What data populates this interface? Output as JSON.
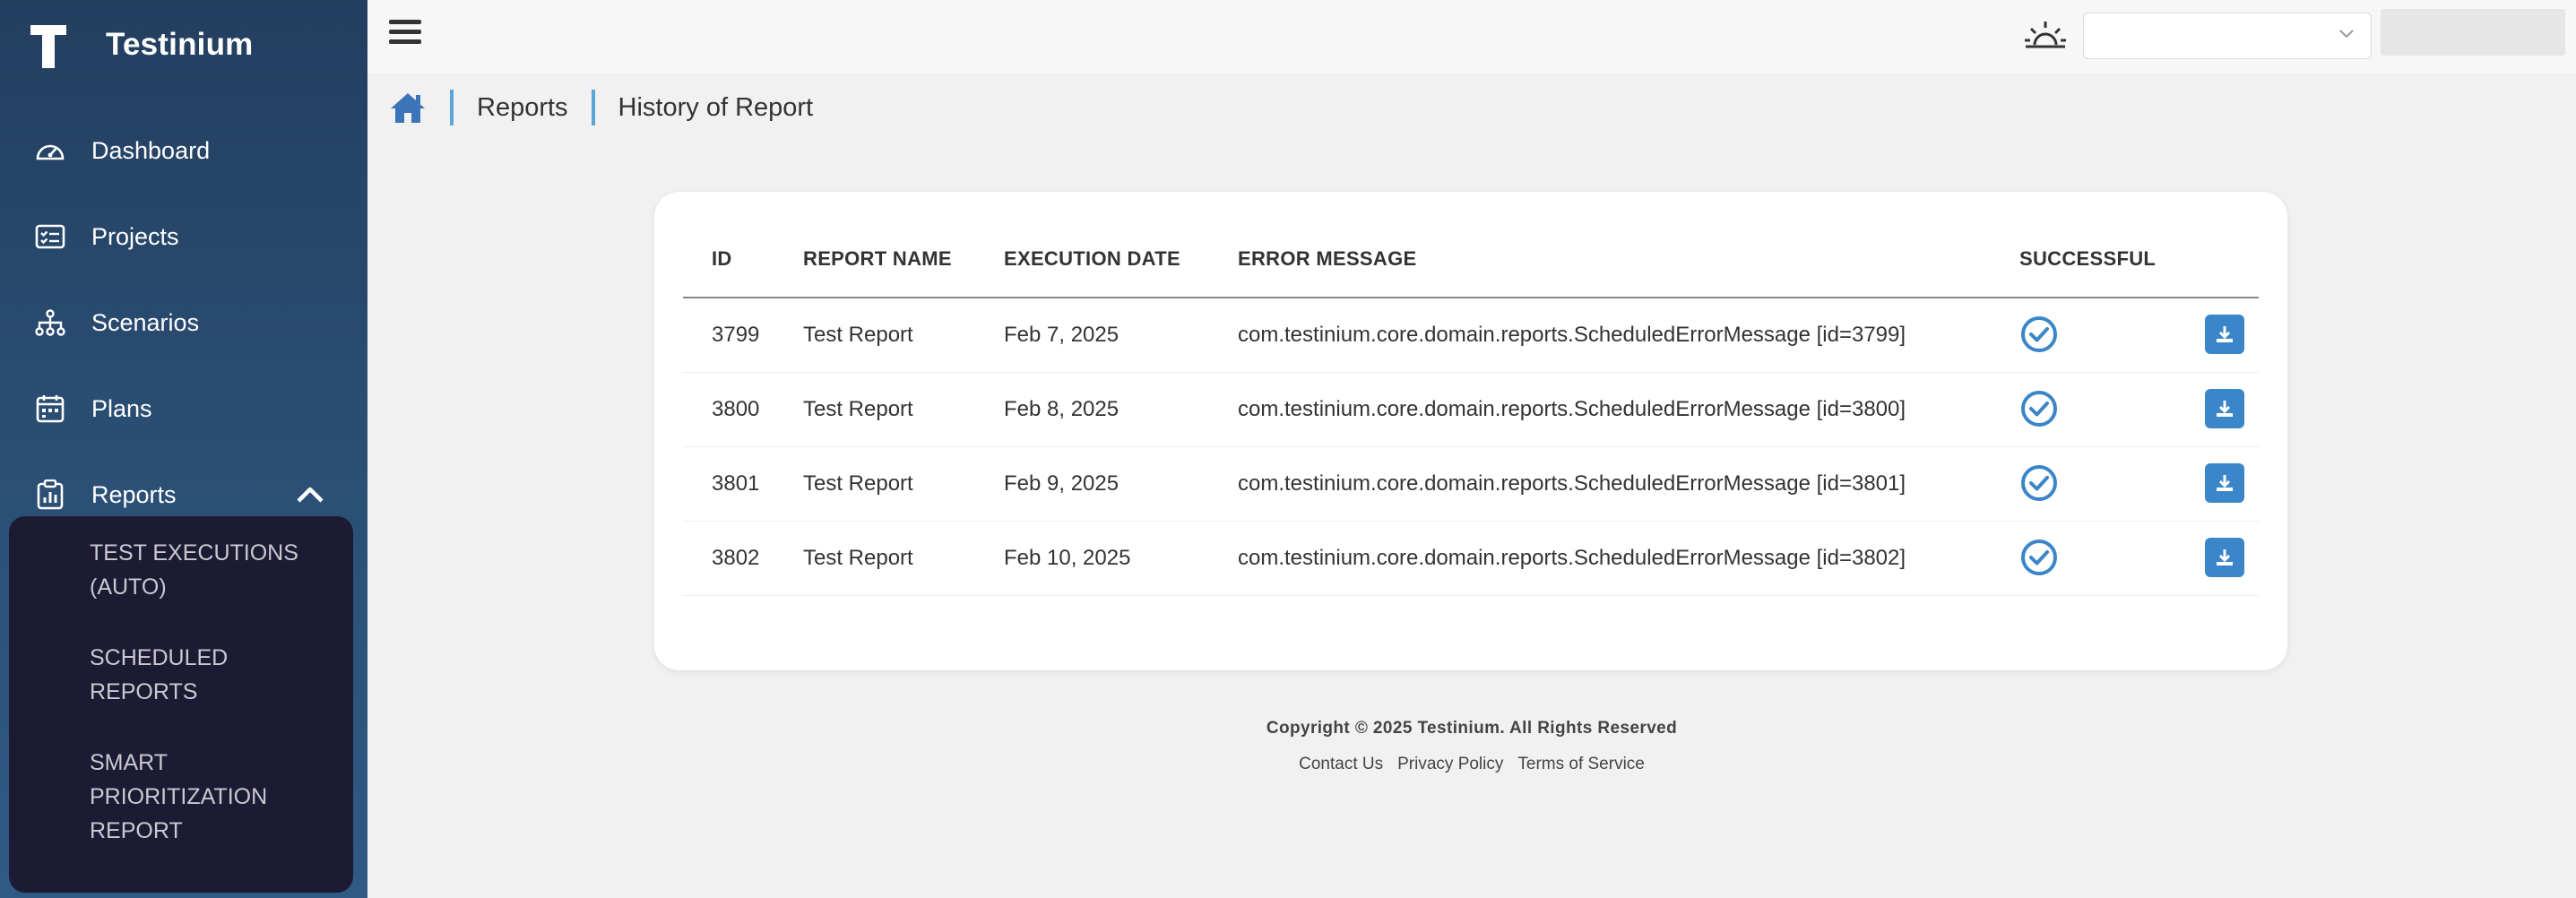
{
  "brand": {
    "name": "Testinium"
  },
  "sidebar": {
    "items": [
      {
        "label": "Dashboard",
        "icon": "gauge-icon"
      },
      {
        "label": "Projects",
        "icon": "checklist-icon"
      },
      {
        "label": "Scenarios",
        "icon": "hierarchy-icon"
      },
      {
        "label": "Plans",
        "icon": "calendar-icon"
      },
      {
        "label": "Reports",
        "icon": "clipboard-chart-icon",
        "expanded": true
      }
    ],
    "submenu": [
      {
        "label": "TEST EXECUTIONS (AUTO)"
      },
      {
        "label": "SCHEDULED REPORTS"
      },
      {
        "label": "SMART PRIORITIZATION REPORT"
      }
    ]
  },
  "topbar": {
    "select_value": ""
  },
  "breadcrumb": {
    "items": [
      "Reports",
      "History of Report"
    ]
  },
  "table": {
    "columns": [
      "ID",
      "REPORT NAME",
      "EXECUTION DATE",
      "ERROR MESSAGE",
      "SUCCESSFUL"
    ],
    "rows": [
      {
        "id": "3799",
        "report_name": "Test Report",
        "execution_date": "Feb 7, 2025",
        "error_message": "com.testinium.core.domain.reports.ScheduledErrorMessage [id=3799]",
        "successful": true
      },
      {
        "id": "3800",
        "report_name": "Test Report",
        "execution_date": "Feb 8, 2025",
        "error_message": "com.testinium.core.domain.reports.ScheduledErrorMessage [id=3800]",
        "successful": true
      },
      {
        "id": "3801",
        "report_name": "Test Report",
        "execution_date": "Feb 9, 2025",
        "error_message": "com.testinium.core.domain.reports.ScheduledErrorMessage [id=3801]",
        "successful": true
      },
      {
        "id": "3802",
        "report_name": "Test Report",
        "execution_date": "Feb 10, 2025",
        "error_message": "com.testinium.core.domain.reports.ScheduledErrorMessage [id=3802]",
        "successful": true
      }
    ]
  },
  "footer": {
    "copyright": "Copyright © 2025 Testinium. All Rights Reserved",
    "links": [
      "Contact Us",
      "Privacy Policy",
      "Terms of Service"
    ]
  },
  "colors": {
    "sidebar": "#2a4d72",
    "submenu": "#1d1b33",
    "accent": "#3b86c8"
  }
}
